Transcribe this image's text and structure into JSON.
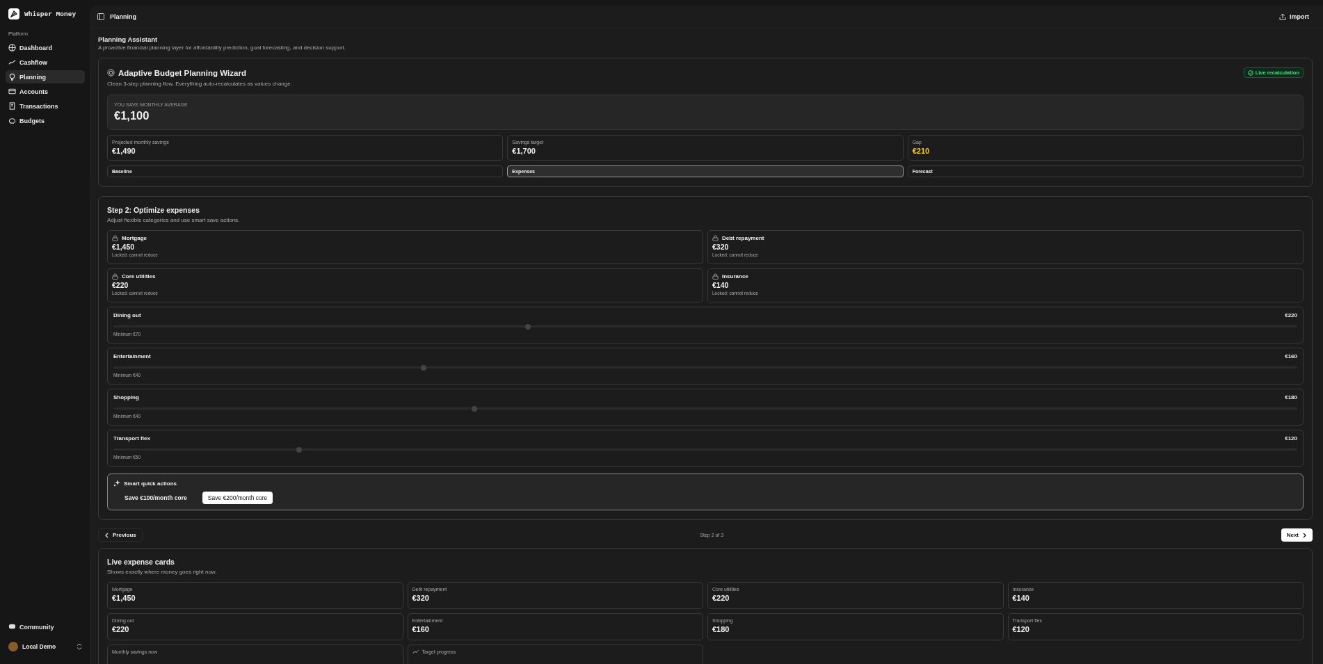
{
  "app": {
    "name": "Whisper Money"
  },
  "sidebar": {
    "section": "Platform",
    "items": [
      {
        "label": "Dashboard",
        "selected": false
      },
      {
        "label": "Cashflow",
        "selected": false
      },
      {
        "label": "Planning",
        "selected": true
      },
      {
        "label": "Accounts",
        "selected": false
      },
      {
        "label": "Transactions",
        "selected": false
      },
      {
        "label": "Budgets",
        "selected": false
      }
    ],
    "community": "Community",
    "user": "Local Demo"
  },
  "header": {
    "title": "Planning",
    "import": "Import"
  },
  "page": {
    "title": "Planning Assistant",
    "subtitle": "A proactive financial planning layer for affordability prediction, goal forecasting, and decision support."
  },
  "wizard": {
    "title": "Adaptive Budget Planning Wizard",
    "subtitle": "Clean 3-step planning flow. Everything auto-recalculates as values change.",
    "badge": "Live recalculation",
    "hero": {
      "label": "YOU SAVE MONTHLY AVERAGE",
      "value": "€1,100"
    },
    "stats": [
      {
        "label": "Projected monthly savings",
        "value": "€1,490",
        "highlighted": false
      },
      {
        "label": "Savings target",
        "value": "€1,700",
        "highlighted": false
      },
      {
        "label": "Gap",
        "value": "€210",
        "highlighted": true
      }
    ],
    "steps": [
      {
        "label": "Baseline",
        "selected": false
      },
      {
        "label": "Expenses",
        "selected": true
      },
      {
        "label": "Forecast",
        "selected": false
      }
    ]
  },
  "step": {
    "title": "Step 2: Optimize expenses",
    "subtitle": "Adjust flexible categories and use smart save actions.",
    "locked": [
      {
        "name": "Mortgage",
        "value": "€1,450",
        "note": "Locked: cannot reduce"
      },
      {
        "name": "Debt repayment",
        "value": "€320",
        "note": "Locked: cannot reduce"
      },
      {
        "name": "Core utilities",
        "value": "€220",
        "note": "Locked: cannot reduce"
      },
      {
        "name": "Insurance",
        "value": "€140",
        "note": "Locked: cannot reduce"
      }
    ],
    "flexible": [
      {
        "name": "Dining out",
        "value": "€220",
        "minimum": "Minimum €70",
        "level": 0.35
      },
      {
        "name": "Entertainment",
        "value": "€160",
        "minimum": "Minimum €40",
        "level": 0.262
      },
      {
        "name": "Shopping",
        "value": "€180",
        "minimum": "Minimum €40",
        "level": 0.305
      },
      {
        "name": "Transport flex",
        "value": "€120",
        "minimum": "Minimum €50",
        "level": 0.157
      }
    ],
    "quick_actions": {
      "title": "Smart quick actions",
      "buttons": [
        {
          "label": "Save €100/month core",
          "selected": false
        },
        {
          "label": "Save €200/month core",
          "selected": true
        }
      ]
    }
  },
  "nav": {
    "previous": "Previous",
    "progress": "Step 2 of 3",
    "next": "Next"
  },
  "live": {
    "title": "Live expense cards",
    "subtitle": "Shows exactly where money goes right now.",
    "cards": [
      {
        "label": "Mortgage",
        "value": "€1,450"
      },
      {
        "label": "Debt repayment",
        "value": "€320"
      },
      {
        "label": "Core utilities",
        "value": "€220"
      },
      {
        "label": "Insurance",
        "value": "€140"
      },
      {
        "label": "Dining out",
        "value": "€220"
      },
      {
        "label": "Entertainment",
        "value": "€160"
      },
      {
        "label": "Shopping",
        "value": "€180"
      },
      {
        "label": "Transport flex",
        "value": "€120"
      }
    ],
    "summary": [
      {
        "label": "Monthly savings now",
        "kind": "plain"
      },
      {
        "label": "Target progress",
        "kind": "trend"
      }
    ]
  }
}
